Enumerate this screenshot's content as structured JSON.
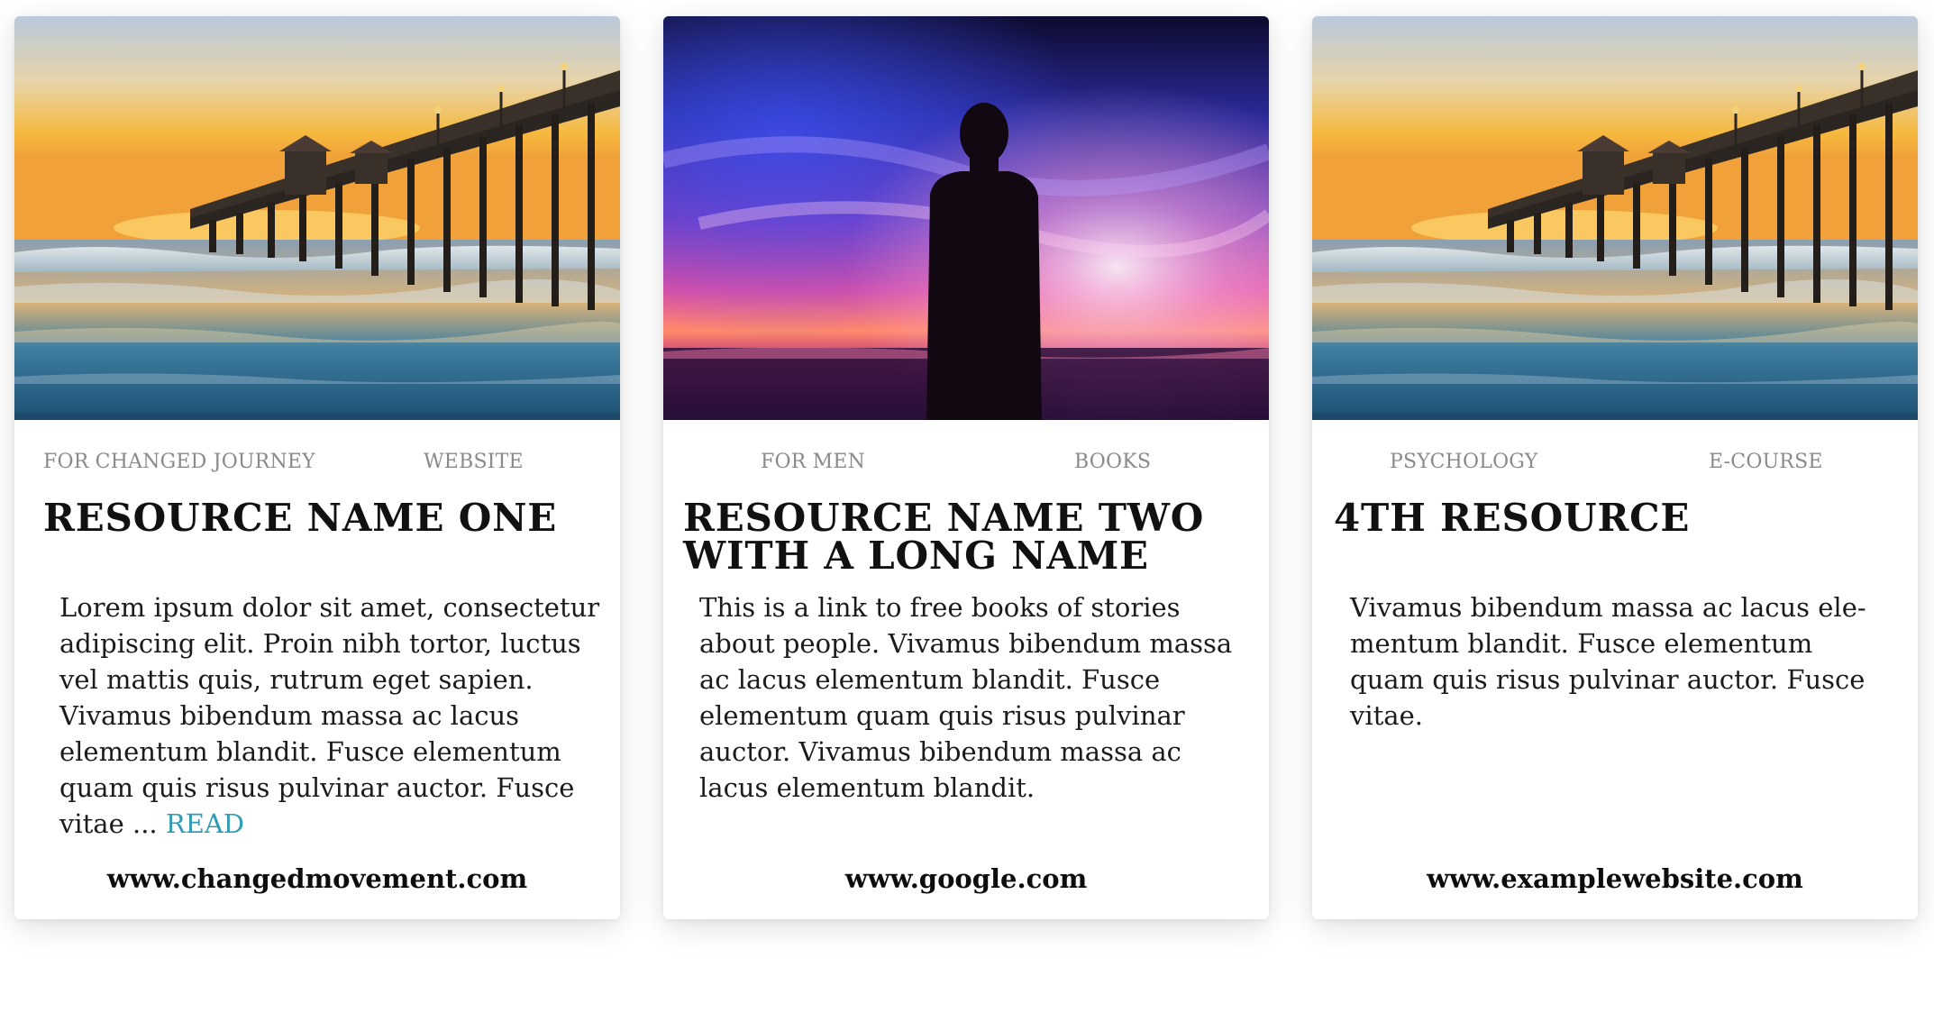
{
  "cards": [
    {
      "image": "pier-sunset",
      "category": "FOR CHANGED JOURNEY",
      "type": "WEBSITE",
      "title": "RESOURCE NAME ONE",
      "description": "Lorem ipsum dolor sit amet, consectetur adipiscing elit. Proin nibh tortor, luctus vel mattis quis, rutrum eget sapien. Vivamus bibendum massa ac lacus elementum blandit. Fusce elementum quam quis risus pulvinar auctor. Fusce vitae ...",
      "read_label": "READ",
      "url": "www.changedmovement.com"
    },
    {
      "image": "silhouette-sunset",
      "category": "FOR MEN",
      "type": "BOOKS",
      "title": "RESOURCE NAME TWO WITH A LONG NAME",
      "description": "This is a link to free books of stories about people. Vivamus bibendum massa ac lacus elementum blandit. Fusce elementum quam quis risus pulvinar auctor. Vivamus bibendum massa ac lacus elementum blandit.",
      "url": "www.google.com"
    },
    {
      "image": "pier-sunset",
      "category": "PSYCHOLOGY",
      "type": "E-COURSE",
      "title": "4TH RESOURCE",
      "description": "Vivamus bibendum massa ac lacus ele-mentum blandit. Fusce elementum quam quis risus pulvinar auctor. Fusce vitae.",
      "url": "www.examplewebsite.com"
    }
  ],
  "colors": {
    "link": "#2f9bb4",
    "meta_text": "#8a8a8a",
    "title_text": "#111111"
  }
}
